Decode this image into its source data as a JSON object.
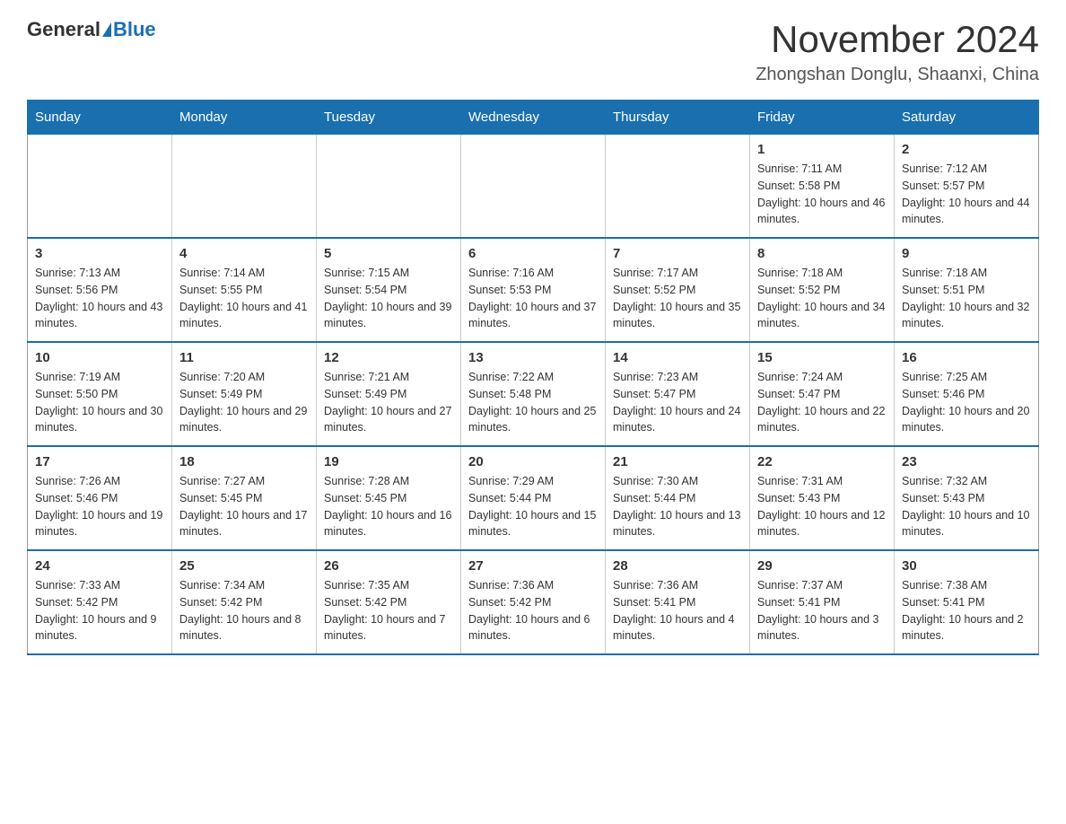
{
  "logo": {
    "general": "General",
    "blue": "Blue"
  },
  "header": {
    "month_year": "November 2024",
    "location": "Zhongshan Donglu, Shaanxi, China"
  },
  "days_of_week": [
    "Sunday",
    "Monday",
    "Tuesday",
    "Wednesday",
    "Thursday",
    "Friday",
    "Saturday"
  ],
  "weeks": [
    [
      {
        "day": "",
        "info": ""
      },
      {
        "day": "",
        "info": ""
      },
      {
        "day": "",
        "info": ""
      },
      {
        "day": "",
        "info": ""
      },
      {
        "day": "",
        "info": ""
      },
      {
        "day": "1",
        "info": "Sunrise: 7:11 AM\nSunset: 5:58 PM\nDaylight: 10 hours and 46 minutes."
      },
      {
        "day": "2",
        "info": "Sunrise: 7:12 AM\nSunset: 5:57 PM\nDaylight: 10 hours and 44 minutes."
      }
    ],
    [
      {
        "day": "3",
        "info": "Sunrise: 7:13 AM\nSunset: 5:56 PM\nDaylight: 10 hours and 43 minutes."
      },
      {
        "day": "4",
        "info": "Sunrise: 7:14 AM\nSunset: 5:55 PM\nDaylight: 10 hours and 41 minutes."
      },
      {
        "day": "5",
        "info": "Sunrise: 7:15 AM\nSunset: 5:54 PM\nDaylight: 10 hours and 39 minutes."
      },
      {
        "day": "6",
        "info": "Sunrise: 7:16 AM\nSunset: 5:53 PM\nDaylight: 10 hours and 37 minutes."
      },
      {
        "day": "7",
        "info": "Sunrise: 7:17 AM\nSunset: 5:52 PM\nDaylight: 10 hours and 35 minutes."
      },
      {
        "day": "8",
        "info": "Sunrise: 7:18 AM\nSunset: 5:52 PM\nDaylight: 10 hours and 34 minutes."
      },
      {
        "day": "9",
        "info": "Sunrise: 7:18 AM\nSunset: 5:51 PM\nDaylight: 10 hours and 32 minutes."
      }
    ],
    [
      {
        "day": "10",
        "info": "Sunrise: 7:19 AM\nSunset: 5:50 PM\nDaylight: 10 hours and 30 minutes."
      },
      {
        "day": "11",
        "info": "Sunrise: 7:20 AM\nSunset: 5:49 PM\nDaylight: 10 hours and 29 minutes."
      },
      {
        "day": "12",
        "info": "Sunrise: 7:21 AM\nSunset: 5:49 PM\nDaylight: 10 hours and 27 minutes."
      },
      {
        "day": "13",
        "info": "Sunrise: 7:22 AM\nSunset: 5:48 PM\nDaylight: 10 hours and 25 minutes."
      },
      {
        "day": "14",
        "info": "Sunrise: 7:23 AM\nSunset: 5:47 PM\nDaylight: 10 hours and 24 minutes."
      },
      {
        "day": "15",
        "info": "Sunrise: 7:24 AM\nSunset: 5:47 PM\nDaylight: 10 hours and 22 minutes."
      },
      {
        "day": "16",
        "info": "Sunrise: 7:25 AM\nSunset: 5:46 PM\nDaylight: 10 hours and 20 minutes."
      }
    ],
    [
      {
        "day": "17",
        "info": "Sunrise: 7:26 AM\nSunset: 5:46 PM\nDaylight: 10 hours and 19 minutes."
      },
      {
        "day": "18",
        "info": "Sunrise: 7:27 AM\nSunset: 5:45 PM\nDaylight: 10 hours and 17 minutes."
      },
      {
        "day": "19",
        "info": "Sunrise: 7:28 AM\nSunset: 5:45 PM\nDaylight: 10 hours and 16 minutes."
      },
      {
        "day": "20",
        "info": "Sunrise: 7:29 AM\nSunset: 5:44 PM\nDaylight: 10 hours and 15 minutes."
      },
      {
        "day": "21",
        "info": "Sunrise: 7:30 AM\nSunset: 5:44 PM\nDaylight: 10 hours and 13 minutes."
      },
      {
        "day": "22",
        "info": "Sunrise: 7:31 AM\nSunset: 5:43 PM\nDaylight: 10 hours and 12 minutes."
      },
      {
        "day": "23",
        "info": "Sunrise: 7:32 AM\nSunset: 5:43 PM\nDaylight: 10 hours and 10 minutes."
      }
    ],
    [
      {
        "day": "24",
        "info": "Sunrise: 7:33 AM\nSunset: 5:42 PM\nDaylight: 10 hours and 9 minutes."
      },
      {
        "day": "25",
        "info": "Sunrise: 7:34 AM\nSunset: 5:42 PM\nDaylight: 10 hours and 8 minutes."
      },
      {
        "day": "26",
        "info": "Sunrise: 7:35 AM\nSunset: 5:42 PM\nDaylight: 10 hours and 7 minutes."
      },
      {
        "day": "27",
        "info": "Sunrise: 7:36 AM\nSunset: 5:42 PM\nDaylight: 10 hours and 6 minutes."
      },
      {
        "day": "28",
        "info": "Sunrise: 7:36 AM\nSunset: 5:41 PM\nDaylight: 10 hours and 4 minutes."
      },
      {
        "day": "29",
        "info": "Sunrise: 7:37 AM\nSunset: 5:41 PM\nDaylight: 10 hours and 3 minutes."
      },
      {
        "day": "30",
        "info": "Sunrise: 7:38 AM\nSunset: 5:41 PM\nDaylight: 10 hours and 2 minutes."
      }
    ]
  ]
}
